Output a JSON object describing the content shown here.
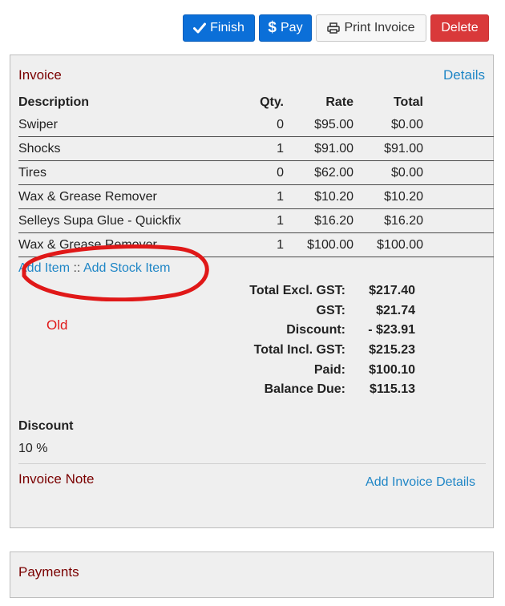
{
  "toolbar": {
    "finish_label": "Finish",
    "pay_label": "Pay",
    "print_label": "Print Invoice",
    "delete_label": "Delete"
  },
  "invoice": {
    "heading": "Invoice",
    "details_link": "Details",
    "columns": {
      "description": "Description",
      "qty": "Qty.",
      "rate": "Rate",
      "total": "Total"
    },
    "items": [
      {
        "description": "Swiper",
        "qty": "0",
        "rate": "$95.00",
        "total": "$0.00"
      },
      {
        "description": "Shocks",
        "qty": "1",
        "rate": "$91.00",
        "total": "$91.00"
      },
      {
        "description": "Tires",
        "qty": "0",
        "rate": "$62.00",
        "total": "$0.00"
      },
      {
        "description": "Wax & Grease Remover",
        "qty": "1",
        "rate": "$10.20",
        "total": "$10.20"
      },
      {
        "description": "Selleys Supa Glue - Quickfix",
        "qty": "1",
        "rate": "$16.20",
        "total": "$16.20"
      },
      {
        "description": "Wax & Grease Remover",
        "qty": "1",
        "rate": "$100.00",
        "total": "$100.00"
      }
    ],
    "add_item_link": "Add Item",
    "link_separator": "::",
    "add_stock_item_link": "Add Stock Item",
    "totals": [
      {
        "label": "Total Excl. GST:",
        "value": "$217.40"
      },
      {
        "label": "GST:",
        "value": "$21.74"
      },
      {
        "label": "Discount:",
        "value": "- $23.91"
      },
      {
        "label": "Total Incl. GST:",
        "value": "$215.23"
      },
      {
        "label": "Paid:",
        "value": "$100.10"
      },
      {
        "label": "Balance Due:",
        "value": "$115.13"
      }
    ],
    "annotation_text": "Old",
    "discount_heading": "Discount",
    "discount_value": "10 %",
    "note_heading": "Invoice Note",
    "add_details_link": "Add Invoice Details"
  },
  "payments": {
    "heading": "Payments"
  },
  "colors": {
    "primary": "#0b6fd8",
    "danger": "#d9393a",
    "heading": "#7a0000",
    "link": "#1f86c6",
    "annotation": "#e01818"
  }
}
